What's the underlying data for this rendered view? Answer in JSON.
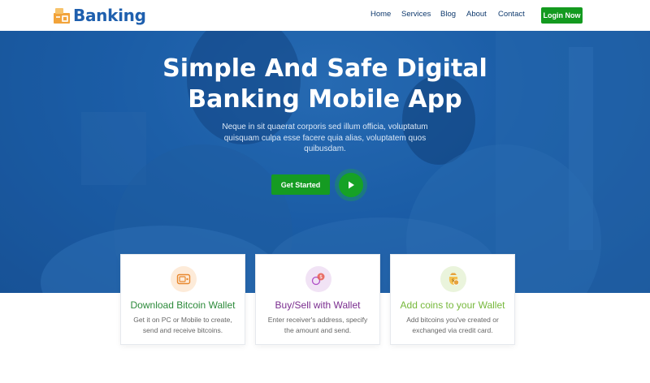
{
  "header": {
    "brand": "Banking",
    "nav": [
      {
        "label": "Home"
      },
      {
        "label": "Services"
      },
      {
        "label": "Blog"
      },
      {
        "label": "About"
      },
      {
        "label": "Contact"
      }
    ],
    "login_label": "Login Now"
  },
  "hero": {
    "title_line1": "Simple And Safe Digital",
    "title_line2": "Banking Mobile App",
    "subtitle_line1": "Neque in sit quaerat corporis sed illum officia, voluptatum",
    "subtitle_line2": "quisquam culpa esse facere quia alias, voluptatem quos",
    "subtitle_line3": "quibusdam.",
    "cta_label": "Get Started"
  },
  "cards": [
    {
      "icon": "wallet-icon",
      "title": "Download Bitcoin Wallet",
      "text_line1": "Get it on PC or Mobile to create,",
      "text_line2": "send and receive bitcoins.",
      "color": "#2c8a3a"
    },
    {
      "icon": "exchange-icon",
      "title": "Buy/Sell with Wallet",
      "text_line1": "Enter receiver's address, specify",
      "text_line2": "the amount and send.",
      "color": "#7a2d8f"
    },
    {
      "icon": "coin-bag-icon",
      "title": "Add coins to your Wallet",
      "text_line1": "Add bitcoins you've created or",
      "text_line2": "exchanged via credit card.",
      "color": "#76b83b"
    }
  ],
  "colors": {
    "brand": "#1e5fae",
    "accent_green": "#139a1f",
    "hero_blue": "#1b5ea8"
  }
}
